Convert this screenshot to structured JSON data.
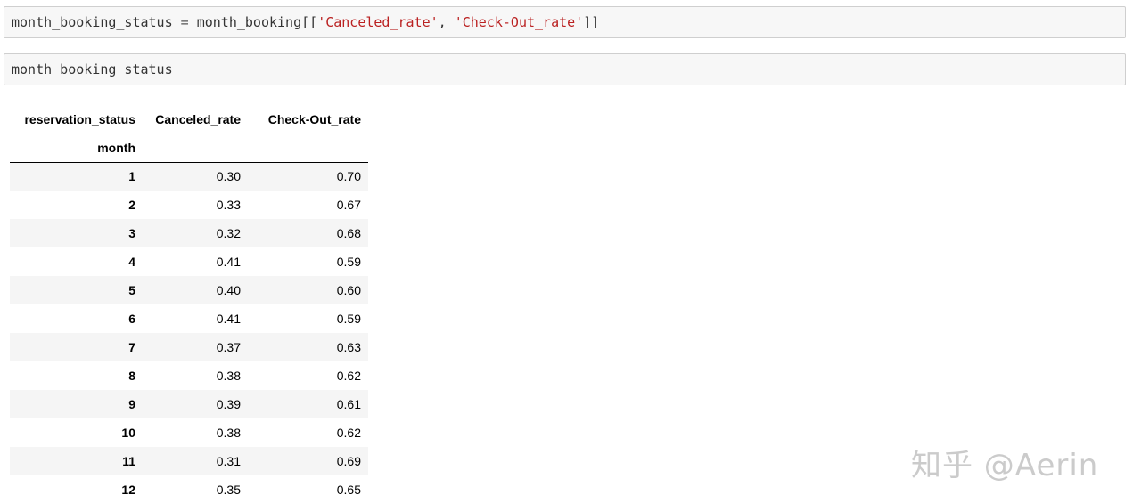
{
  "cells": {
    "code1": {
      "var": "month_booking_status",
      "op": " = ",
      "obj": "month_booking",
      "open": "[[",
      "str1": "'Canceled_rate'",
      "sep": ", ",
      "str2": "'Check-Out_rate'",
      "close": "]]"
    },
    "code2": {
      "text": "month_booking_status"
    }
  },
  "dataframe": {
    "columns_name": "reservation_status",
    "columns": [
      "Canceled_rate",
      "Check-Out_rate"
    ],
    "index_name": "month",
    "rows": [
      {
        "month": "1",
        "canceled": "0.30",
        "checkout": "0.70"
      },
      {
        "month": "2",
        "canceled": "0.33",
        "checkout": "0.67"
      },
      {
        "month": "3",
        "canceled": "0.32",
        "checkout": "0.68"
      },
      {
        "month": "4",
        "canceled": "0.41",
        "checkout": "0.59"
      },
      {
        "month": "5",
        "canceled": "0.40",
        "checkout": "0.60"
      },
      {
        "month": "6",
        "canceled": "0.41",
        "checkout": "0.59"
      },
      {
        "month": "7",
        "canceled": "0.37",
        "checkout": "0.63"
      },
      {
        "month": "8",
        "canceled": "0.38",
        "checkout": "0.62"
      },
      {
        "month": "9",
        "canceled": "0.39",
        "checkout": "0.61"
      },
      {
        "month": "10",
        "canceled": "0.38",
        "checkout": "0.62"
      },
      {
        "month": "11",
        "canceled": "0.31",
        "checkout": "0.69"
      },
      {
        "month": "12",
        "canceled": "0.35",
        "checkout": "0.65"
      }
    ]
  },
  "watermark": "知乎 @Aerin"
}
